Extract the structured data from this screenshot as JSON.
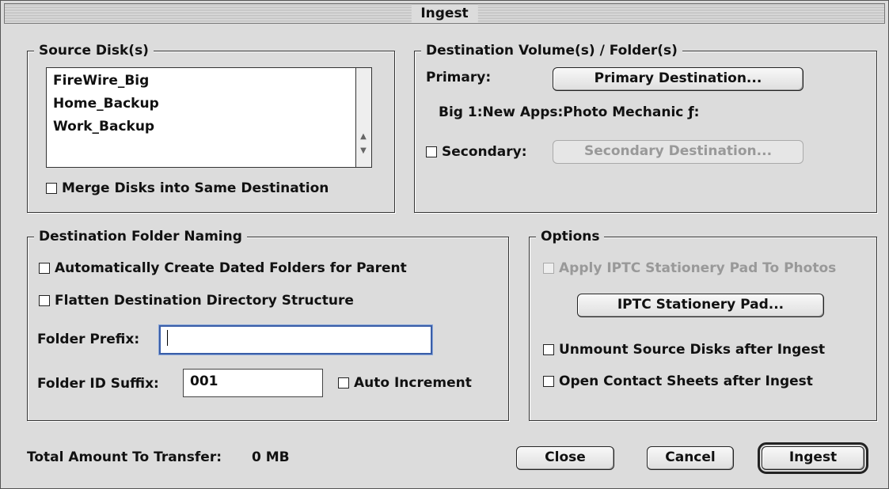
{
  "window": {
    "title": "Ingest"
  },
  "source": {
    "title": "Source Disk(s)",
    "items": [
      "FireWire_Big",
      "Home_Backup",
      "Work_Backup"
    ],
    "merge_label": "Merge Disks into Same Destination",
    "merge_checked": false
  },
  "destination": {
    "title": "Destination Volume(s) / Folder(s)",
    "primary_label": "Primary:",
    "primary_button": "Primary Destination...",
    "primary_path": "Big 1:New Apps:Photo Mechanic ƒ:",
    "secondary_label": "Secondary:",
    "secondary_checked": false,
    "secondary_button": "Secondary Destination..."
  },
  "naming": {
    "title": "Destination Folder Naming",
    "auto_dated_label": "Automatically Create Dated Folders for Parent",
    "flatten_label": "Flatten Destination Directory Structure",
    "prefix_label": "Folder Prefix:",
    "prefix_value": "",
    "suffix_label": "Folder ID Suffix:",
    "suffix_value": "001",
    "auto_increment_label": "Auto Increment"
  },
  "options": {
    "title": "Options",
    "apply_iptc_label": "Apply IPTC Stationery Pad To Photos",
    "iptc_button": "IPTC Stationery Pad...",
    "unmount_label": "Unmount Source Disks after Ingest",
    "contact_sheets_label": "Open Contact Sheets after Ingest"
  },
  "footer": {
    "total_label": "Total Amount To Transfer:",
    "total_value": "0 MB",
    "close_button": "Close",
    "cancel_button": "Cancel",
    "ingest_button": "Ingest"
  }
}
